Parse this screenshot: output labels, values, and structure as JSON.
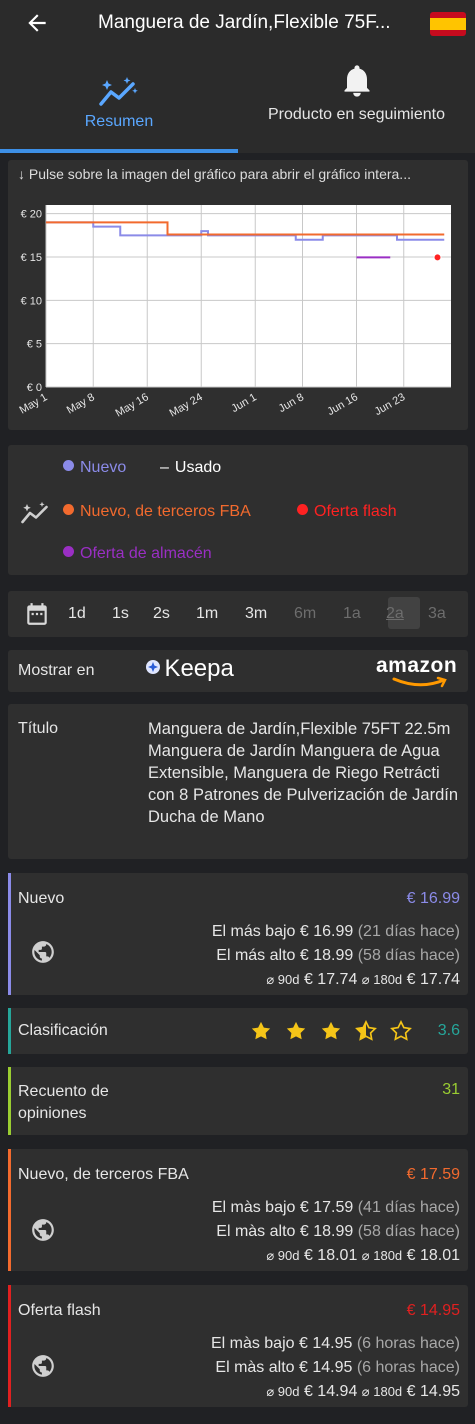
{
  "header": {
    "back_icon": "arrow-left-icon",
    "title": "Manguera de Jardín,Flexible 75F...",
    "flag_icon": "spain-flag-icon"
  },
  "tabs": [
    {
      "label": "Resumen",
      "icon": "chart-sparkle-icon",
      "active": true
    },
    {
      "label": "Producto en seguimiento",
      "icon": "bell-icon",
      "active": false
    }
  ],
  "chart_card": {
    "hint": "↓ Pulse sobre la imagen del gráfico para abrir el gráfico intera..."
  },
  "chart_data": {
    "type": "line",
    "y_ticks": [
      "€ 20",
      "€ 15",
      "€ 10",
      "€ 5",
      "€ 0"
    ],
    "x_ticks": [
      "May 1",
      "May 8",
      "May 16",
      "May 24",
      "Jun 1",
      "Jun 8",
      "Jun 16",
      "Jun 23"
    ],
    "ylim": [
      0,
      21
    ],
    "grid": true,
    "series": [
      {
        "name": "Nuevo",
        "color": "#8b8be8",
        "x": [
          "May 1",
          "May 8",
          "May 12",
          "May 19",
          "May 24",
          "May 25",
          "Jun 7",
          "Jun 11",
          "Jun 22",
          "Jun 29"
        ],
        "y": [
          18.99,
          18.5,
          17.5,
          17.5,
          17.99,
          17.5,
          16.99,
          17.5,
          16.99,
          16.99
        ]
      },
      {
        "name": "Nuevo, de terceros FBA",
        "color": "#f26a2e",
        "x": [
          "May 1",
          "May 18",
          "May 19",
          "Jun 29"
        ],
        "y": [
          18.99,
          18.99,
          17.59,
          17.59
        ]
      },
      {
        "name": "Oferta de almacén",
        "color": "#9a2fc4",
        "x": [
          "Jun 16",
          "Jun 21"
        ],
        "y": [
          14.95,
          14.95
        ]
      },
      {
        "name": "Oferta flash",
        "color": "#ff2222",
        "x": [
          "Jun 28"
        ],
        "y": [
          14.95
        ]
      }
    ]
  },
  "legend": {
    "nuevo": "Nuevo",
    "usado": "Usado",
    "terceros_fba": "Nuevo, de terceros FBA",
    "oferta_flash": "Oferta flash",
    "oferta_almacen": "Oferta de almacén",
    "colors": {
      "nuevo": "#8b8be8",
      "fba": "#f26a2e",
      "flash": "#ff2222",
      "almacen": "#9a2fc4"
    }
  },
  "ranges": {
    "calendar_icon": "calendar-icon",
    "options": [
      "1d",
      "1s",
      "2s",
      "1m",
      "3m",
      "6m",
      "1a",
      "2a",
      "3a"
    ],
    "selected": "2a"
  },
  "show_on": {
    "label": "Mostrar en",
    "keepa": "Keepa",
    "amazon": "amazon"
  },
  "title_row": {
    "label": "Título",
    "value": "Manguera de Jardín,Flexible 75FT 22.5m Manguera de Jardín Manguera de Agua Extensible, Manguera de Riego Retrácti con 8 Patrones de Pulverización de Jardín Ducha de Mano"
  },
  "nuevo": {
    "label": "Nuevo",
    "price": "€ 16.99",
    "low_label": "El más bajo",
    "low": "€ 16.99",
    "low_ago": "(21 días hace)",
    "high_label": "El más alto",
    "high": "€ 18.99",
    "high_ago": "(58 días hace)",
    "avg90_label": "⌀ 90d",
    "avg90": "€ 17.74",
    "avg180_label": "⌀ 180d",
    "avg180": "€ 17.74"
  },
  "clasificacion": {
    "label": "Clasificación",
    "rating": 3.6,
    "rating_text": "3.6"
  },
  "opiniones": {
    "label": "Recuento de opiniones",
    "count": "31"
  },
  "fba": {
    "label": "Nuevo, de terceros FBA",
    "price": "€ 17.59",
    "low_label": "El màs bajo",
    "low": "€ 17.59",
    "low_ago": "(41 días hace)",
    "high_label": "El màs alto",
    "high": "€ 18.99",
    "high_ago": "(58 días hace)",
    "avg90_label": "⌀ 90d",
    "avg90": "€ 18.01",
    "avg180_label": "⌀ 180d",
    "avg180": "€ 18.01"
  },
  "flash": {
    "label": "Oferta flash",
    "price": "€ 14.95",
    "low_label": "El màs bajo",
    "low": "€ 14.95",
    "low_ago": "(6 horas hace)",
    "high_label": "El màs alto",
    "high": "€ 14.95",
    "high_ago": "(6 horas hace)",
    "avg90_label": "⌀ 90d",
    "avg90": "€ 14.94",
    "avg180_label": "⌀ 180d",
    "avg180": "€ 14.95"
  }
}
